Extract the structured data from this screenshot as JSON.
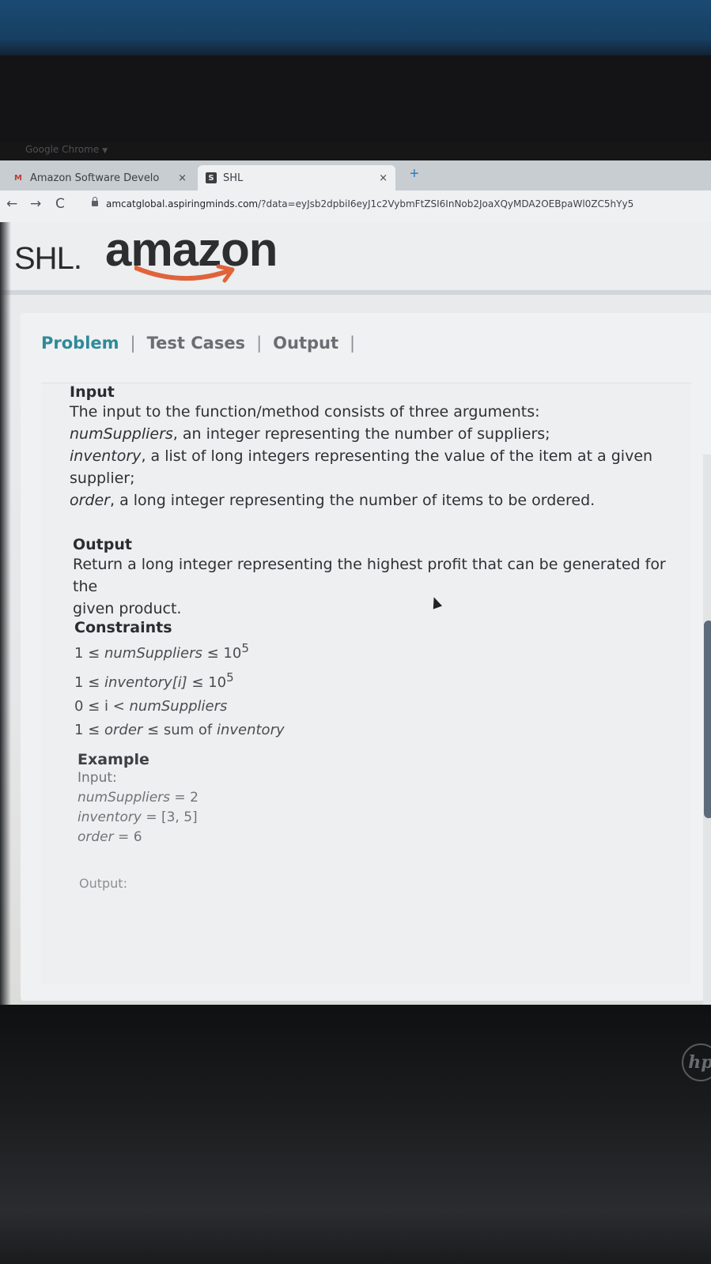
{
  "browser": {
    "app_name": "Google Chrome",
    "tabs": [
      {
        "title": "Amazon Software Develo",
        "favicon": "gmail-m-icon"
      },
      {
        "title": "SHL",
        "favicon": "shl-s-icon"
      }
    ],
    "new_tab_symbol": "+",
    "close_symbol": "×",
    "url_host": "amcatglobal.aspiringminds.com",
    "url_rest": "/?data=eyJsb2dpbiI6eyJ1c2VybmFtZSI6InNob2JoaXQyMDA2OEBpaWl0ZC5hYy5"
  },
  "header": {
    "shl_logo": "SHL.",
    "amazon_logo": "amazon"
  },
  "nav_tabs": [
    {
      "label": "Problem",
      "active": true
    },
    {
      "label": "Test Cases",
      "active": false
    },
    {
      "label": "Output",
      "active": false
    }
  ],
  "problem": {
    "input": {
      "heading": "Input",
      "intro": "The input to the function/method consists of three arguments:",
      "arg1_name": "numSuppliers",
      "arg1_desc": ", an integer representing the number of suppliers;",
      "arg2_name": "inventory",
      "arg2_desc": ", a list of long integers representing the value of the item at a given",
      "arg2_desc_cont": "supplier;",
      "arg3_name": "order",
      "arg3_desc": ", a long integer representing the number of items to be ordered."
    },
    "output": {
      "heading": "Output",
      "line1": "Return a long integer representing the highest profit that can be generated for the",
      "line2": "given product."
    },
    "constraints": {
      "heading": "Constraints",
      "items": [
        {
          "pre": "1 ≤ ",
          "var": "numSuppliers",
          "post": " ≤ 10",
          "sup": "5"
        },
        {
          "pre": "1 ≤ ",
          "var": "inventory[i]",
          "post": " ≤ 10",
          "sup": "5"
        },
        {
          "pre": "0 ≤ i < ",
          "var": "numSuppliers",
          "post": "",
          "sup": ""
        },
        {
          "pre": "1 ≤ ",
          "var": "order",
          "post": " ≤ sum of ",
          "tail": "inventory"
        }
      ]
    },
    "example": {
      "heading": "Example",
      "input_label": "Input:",
      "lines": [
        {
          "var": "numSuppliers",
          "val": " = 2"
        },
        {
          "var": "inventory",
          "val": " = [3, 5]"
        },
        {
          "var": "order",
          "val": " = 6"
        }
      ],
      "output_label": "Output:"
    }
  },
  "scrollbar": {
    "position_fraction": 0.3
  },
  "colors": {
    "active_tab": "#2f8a99",
    "amazon_smile": "#e0633a",
    "page_bg": "#e9ebed"
  }
}
